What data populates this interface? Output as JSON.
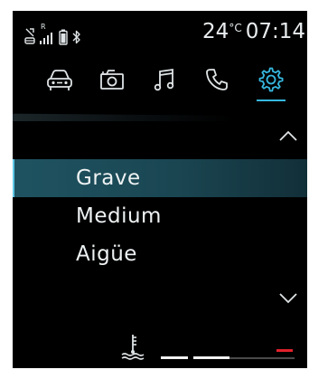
{
  "status_bar": {
    "icons": [
      "car-signal-icon",
      "roaming-signal-icon",
      "phone-battery-icon",
      "bluetooth-icon"
    ],
    "signal_label": "R",
    "temperature": "24",
    "temperature_unit": "°C",
    "time": "07:14"
  },
  "tabs": [
    {
      "name": "car",
      "icon": "car-icon",
      "active": false
    },
    {
      "name": "camera",
      "icon": "camera-icon",
      "active": false
    },
    {
      "name": "music",
      "icon": "music-note-icon",
      "active": false
    },
    {
      "name": "phone",
      "icon": "phone-icon",
      "active": false
    },
    {
      "name": "settings",
      "icon": "gear-icon",
      "active": true
    }
  ],
  "list": {
    "items": [
      {
        "label": "Grave",
        "selected": true
      },
      {
        "label": "Medium",
        "selected": false
      },
      {
        "label": "Aigüe",
        "selected": false
      }
    ]
  },
  "bottom_bar": {
    "coolant_icon": "coolant-temperature-icon",
    "gauge_segments": 4,
    "gauge_lit_segments": 2,
    "warning_color": "#e0212b"
  },
  "colors": {
    "accent": "#36b8e0",
    "selected_row": "#1f5361",
    "background": "#000000"
  }
}
